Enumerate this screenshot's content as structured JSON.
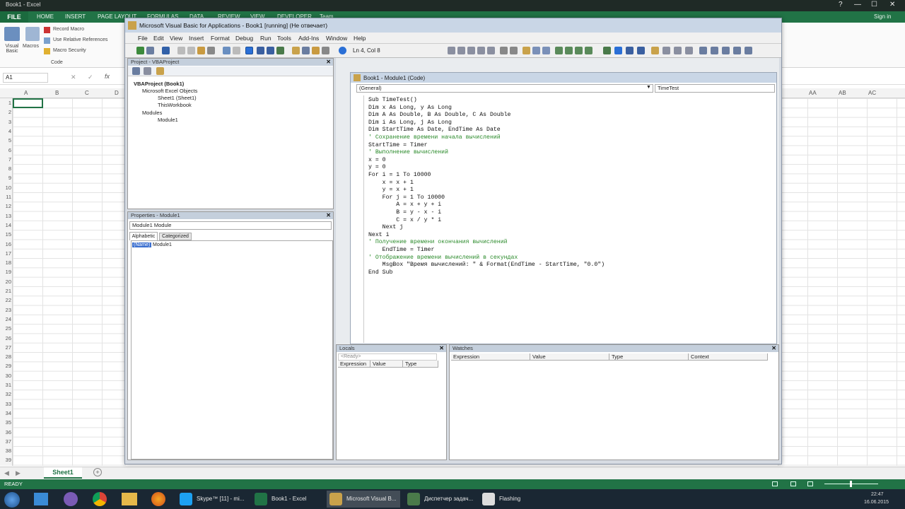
{
  "excel": {
    "title": "Book1 - Excel",
    "window_controls": [
      "?",
      "—",
      "☐",
      "✕"
    ],
    "tabs": [
      "FILE",
      "HOME",
      "INSERT",
      "PAGE LAYOUT",
      "FORMULAS",
      "DATA",
      "REVIEW",
      "VIEW",
      "DEVELOPER",
      "Team"
    ],
    "signin": "Sign in",
    "ribbon": {
      "visual_basic": "Visual Basic",
      "macros": "Macros",
      "record_macro": "Record Macro",
      "relative_refs": "Use Relative References",
      "macro_security": "Macro Security",
      "group_code": "Code"
    },
    "namebox": "A1",
    "columns": [
      "A",
      "B",
      "C",
      "D"
    ],
    "columns_right": [
      "AA",
      "AB",
      "AC"
    ],
    "rows": [
      "1",
      "2",
      "3",
      "4",
      "5",
      "6",
      "7",
      "8",
      "9",
      "10",
      "11",
      "12",
      "13",
      "14",
      "15",
      "16",
      "17",
      "18",
      "19",
      "20",
      "21",
      "22",
      "23",
      "24",
      "25",
      "26",
      "27",
      "28",
      "29",
      "30",
      "31",
      "32",
      "33",
      "34",
      "35",
      "36",
      "37",
      "38",
      "39"
    ],
    "sheet_tab": "Sheet1",
    "status": "READY"
  },
  "taskbar": {
    "items": [
      {
        "label": "Skype™ [11] - mi...",
        "color": "#1da1f2"
      },
      {
        "label": "Book1 - Excel",
        "color": "#217346"
      },
      {
        "label": "Microsoft Visual B...",
        "color": "#c9a24b"
      },
      {
        "label": "Диспетчер задач...",
        "color": "#4a7a4a"
      },
      {
        "label": "Flashing",
        "color": "#dddddd"
      }
    ],
    "clock_time": "22:47",
    "clock_date": "16.06.2015"
  },
  "vbe": {
    "title": "Microsoft Visual Basic for Applications - Book1 [running] (Не отвечает)",
    "menu": [
      "File",
      "Edit",
      "View",
      "Insert",
      "Format",
      "Debug",
      "Run",
      "Tools",
      "Add-Ins",
      "Window",
      "Help"
    ],
    "position": "Ln 4, Col 8",
    "project_title": "Project - VBAProject",
    "tree": [
      "VBAProject (Book1)",
      "Microsoft Excel Objects",
      "Sheet1 (Sheet1)",
      "ThisWorkbook",
      "Modules",
      "Module1"
    ],
    "properties_title": "Properties - Module1",
    "properties_object": "Module1 Module",
    "prop_tabs": [
      "Alphabetic",
      "Categorized"
    ],
    "prop_name_key": "(Name)",
    "prop_name_val": "Module1",
    "code_window_title": "Book1 - Module1 (Code)",
    "general": "(General)",
    "procedure": "TimeTest",
    "code_lines": [
      {
        "t": "Sub TimeTest()",
        "c": false
      },
      {
        "t": "Dim x As Long, y As Long",
        "c": false
      },
      {
        "t": "Dim A As Double, B As Double, C As Double",
        "c": false
      },
      {
        "t": "Dim i As Long, j As Long",
        "c": false
      },
      {
        "t": "Dim StartTime As Date, EndTime As Date",
        "c": false
      },
      {
        "t": "' Сохранение времени начала вычислений",
        "c": true
      },
      {
        "t": "StartTime = Timer",
        "c": false
      },
      {
        "t": "' Выполнение вычислений",
        "c": true
      },
      {
        "t": "x = 0",
        "c": false
      },
      {
        "t": "y = 0",
        "c": false
      },
      {
        "t": "For i = 1 To 10000",
        "c": false
      },
      {
        "t": "    x = x + 1",
        "c": false
      },
      {
        "t": "    y = x + 1",
        "c": false
      },
      {
        "t": "    For j = 1 To 10000",
        "c": false
      },
      {
        "t": "        A = x + y + i",
        "c": false
      },
      {
        "t": "        B = y - x - i",
        "c": false
      },
      {
        "t": "        C = x / y * i",
        "c": false
      },
      {
        "t": "    Next j",
        "c": false
      },
      {
        "t": "Next i",
        "c": false
      },
      {
        "t": "' Получение времени окончания вычислений",
        "c": true
      },
      {
        "t": "    EndTime = Timer",
        "c": false
      },
      {
        "t": "' Отображение времени вычислений в секундах",
        "c": true
      },
      {
        "t": "    MsgBox \"Время вычислений: \" & Format(EndTime - StartTime, \"0.0\")",
        "c": false
      },
      {
        "t": "End Sub",
        "c": false
      }
    ],
    "locals_title": "Locals",
    "locals_ready": "<Ready>",
    "locals_cols": [
      "Expression",
      "Value",
      "Type"
    ],
    "watches_title": "Watches",
    "watches_cols": [
      "Expression",
      "Value",
      "Type",
      "Context"
    ]
  }
}
